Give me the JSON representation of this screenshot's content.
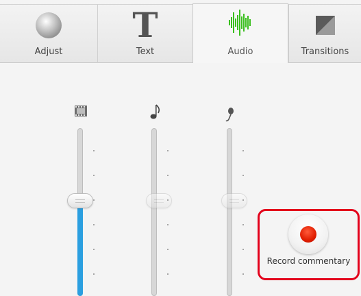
{
  "tabs": [
    {
      "label": "Adjust",
      "icon": "adjust-sphere-icon"
    },
    {
      "label": "Text",
      "icon": "text-t-icon",
      "glyph": "T"
    },
    {
      "label": "Audio",
      "icon": "audio-waveform-icon",
      "active": true
    },
    {
      "label": "Transitions",
      "icon": "transitions-icon"
    }
  ],
  "sliders": [
    {
      "name": "video-volume",
      "icon": "film-icon",
      "level": 0.5,
      "enabled": true
    },
    {
      "name": "music-volume",
      "icon": "music-note-icon",
      "level": 0.5,
      "enabled": false
    },
    {
      "name": "commentary-volume",
      "icon": "microphone-icon",
      "level": 0.5,
      "enabled": false
    }
  ],
  "record": {
    "label": "Record commentary",
    "icon": "record-dot-icon"
  },
  "colors": {
    "accent_fill": "#2b9fe0",
    "record_red": "#e01d00",
    "highlight_border": "#e3001b",
    "audio_icon_green": "#3bbf1f"
  }
}
